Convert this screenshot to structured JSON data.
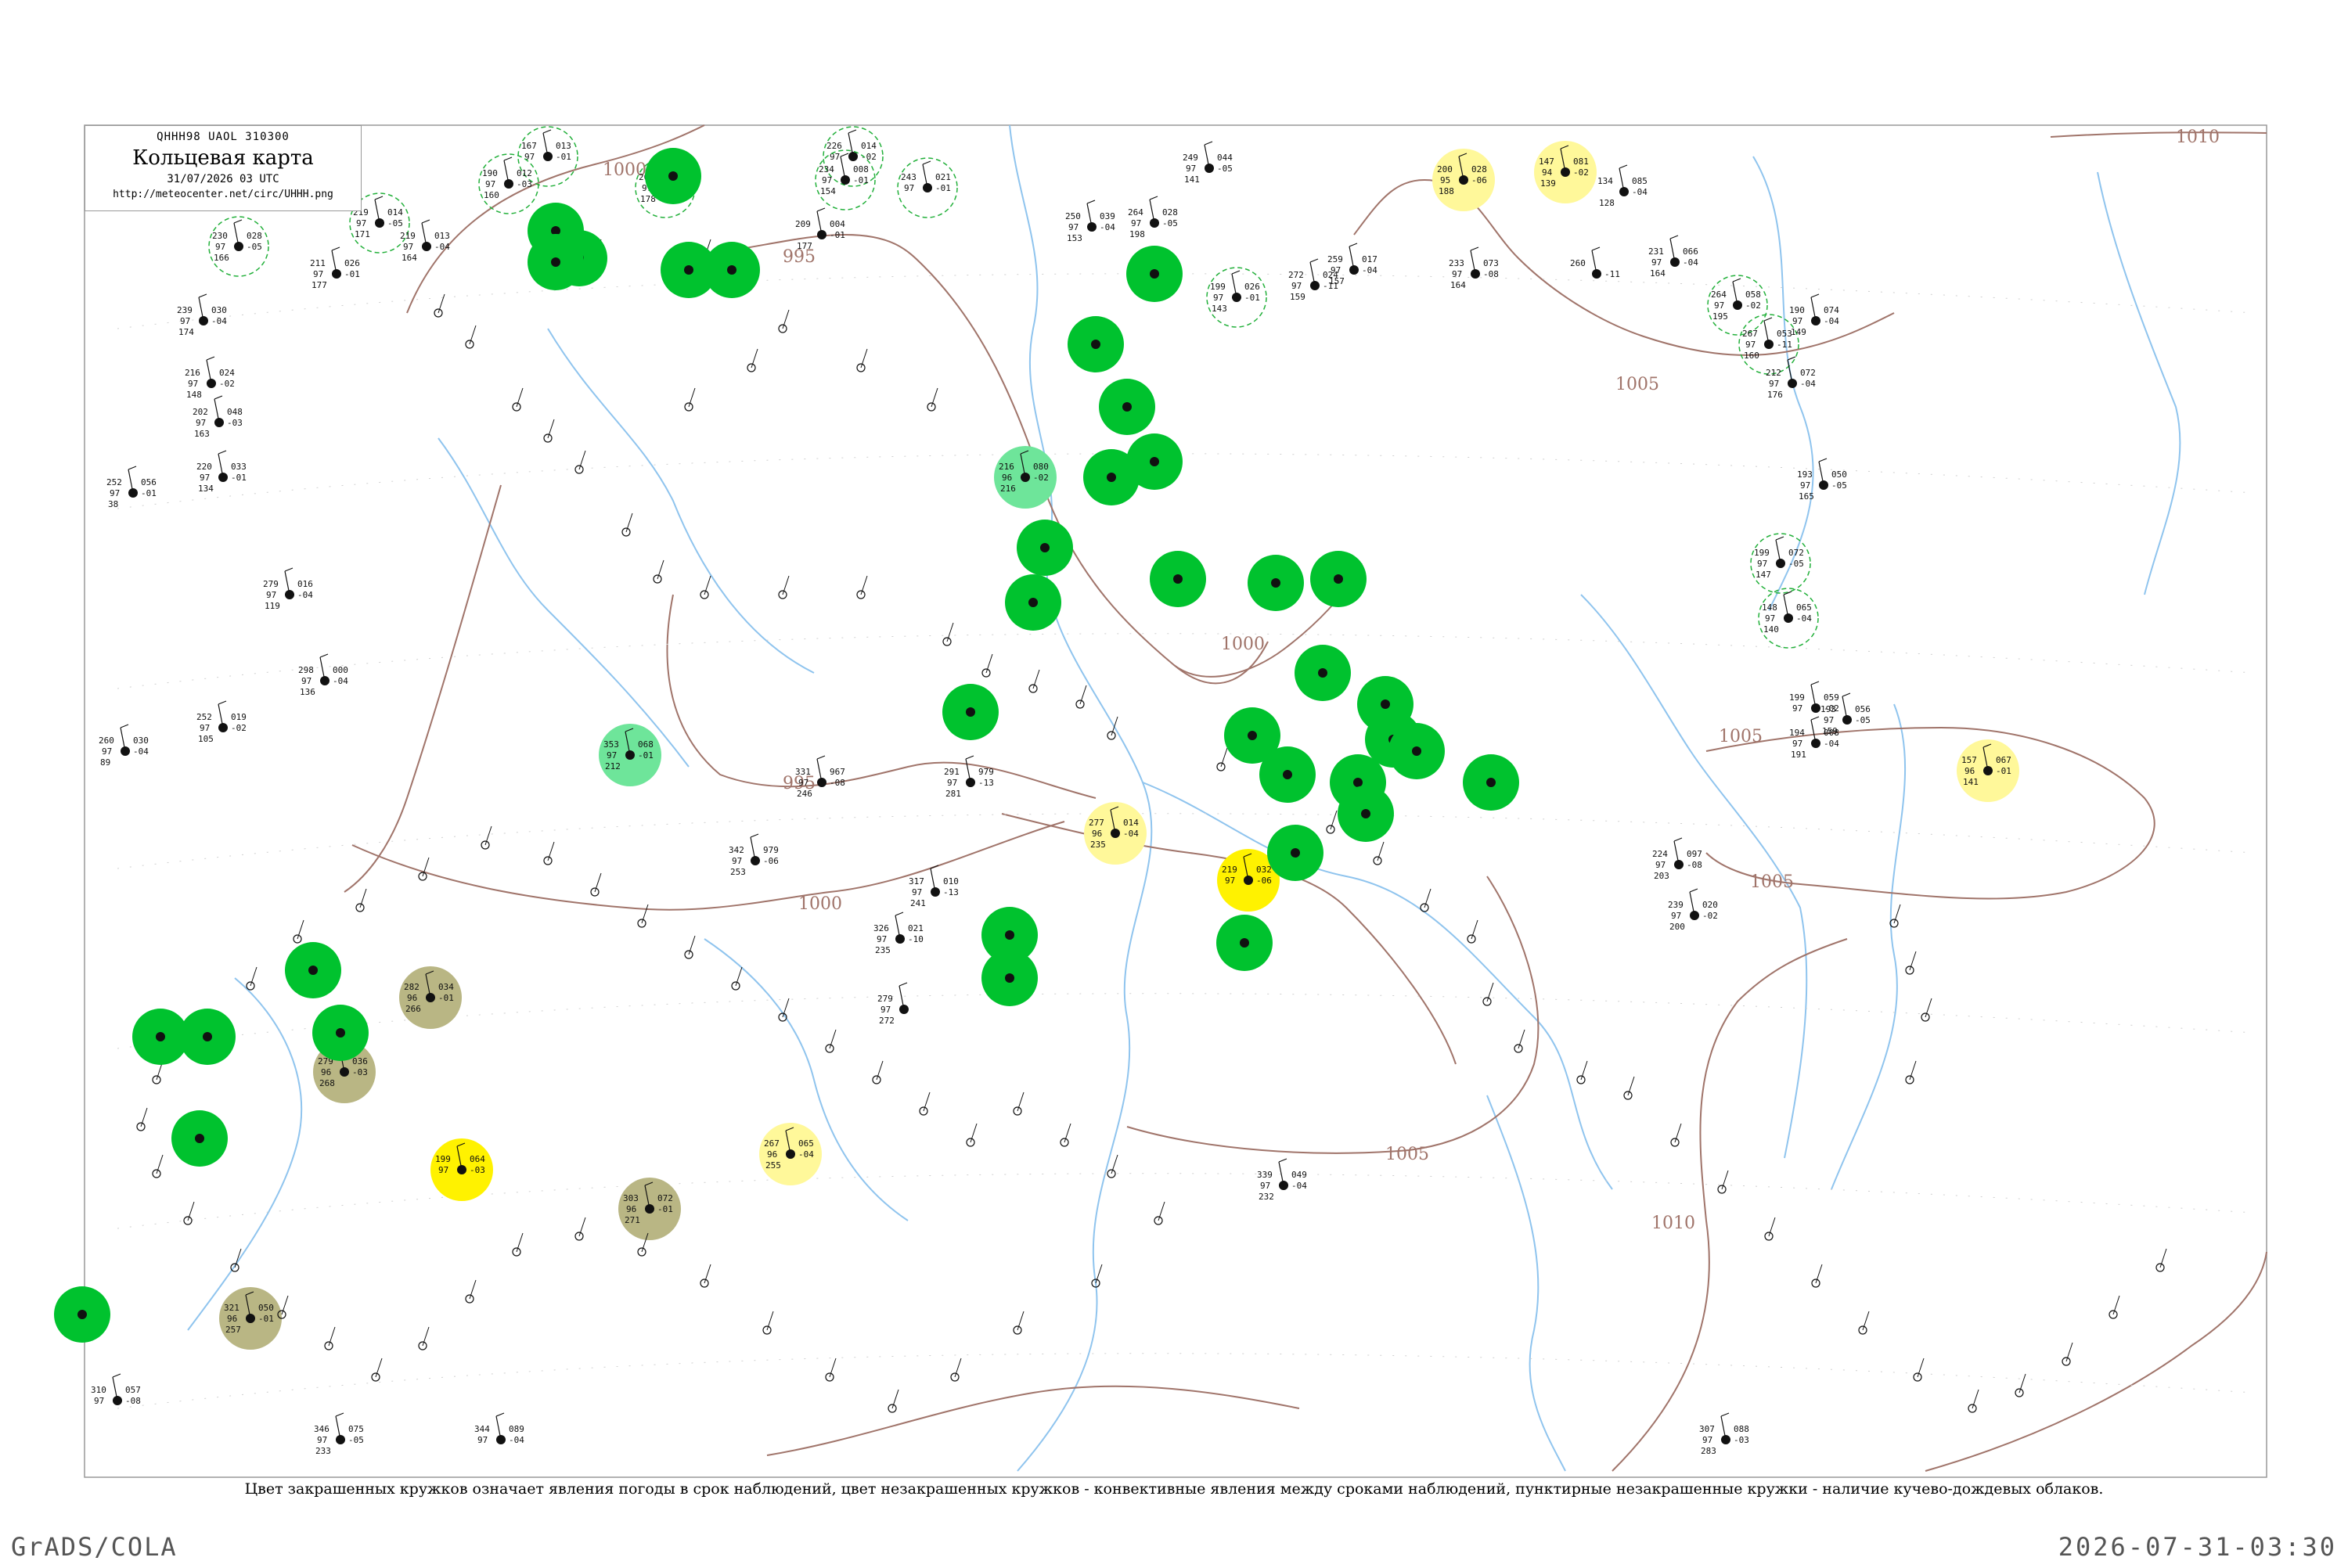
{
  "header": {
    "code": "QHHH98  UAOL  310300",
    "title": "Кольцевая карта",
    "date": "31/07/2026 03 UTC",
    "url": "http://meteocenter.net/circ/UHHH.png"
  },
  "caption": "Цвет закрашенных кружков означает явления погоды в срок наблюдений, цвет незакрашенных кружков - конвективные явления между сроками наблюдений, пунктирные незакрашенные кружки - наличие кучево-дождевых облаков.",
  "footer": {
    "left": "GrADS/COLA",
    "right": "2026-07-31-03:30"
  },
  "colors": {
    "green": "#00c22e",
    "light_green": "#6ee59a",
    "yellow": "#fff200",
    "pale_yellow": "#fff89a",
    "olive": "#b9b684",
    "isobar": "#a0746a",
    "river": "#8fc4ee",
    "dashed_ring": "#22b03a"
  },
  "isobars": [
    {
      "label": "1000",
      "label_pos": "upper-left"
    },
    {
      "label": "995",
      "label_pos": "upper-center"
    },
    {
      "label": "1000",
      "label_pos": "center"
    },
    {
      "label": "995",
      "label_pos": "lower-center"
    },
    {
      "label": "1000",
      "label_pos": "lower-left-center"
    },
    {
      "label": "1005",
      "label_pos": "upper-right"
    },
    {
      "label": "1005",
      "label_pos": "right"
    },
    {
      "label": "1005",
      "label_pos": "lower-center"
    },
    {
      "label": "1005",
      "label_pos": "lower-right"
    },
    {
      "label": "1010",
      "label_pos": "top-right"
    }
  ],
  "stations": [
    {
      "t": "167",
      "p": "013",
      "q": "97",
      "d": "-01",
      "l": "",
      "fill": "none",
      "ring": "dashed"
    },
    {
      "t": "190",
      "p": "012",
      "q": "97",
      "d": "-03",
      "l": "160",
      "fill": "none",
      "ring": "dashed"
    },
    {
      "t": "204",
      "p": "006",
      "q": "97",
      "d": "-04",
      "l": "178",
      "fill": "none",
      "ring": "dashed"
    },
    {
      "t": "226",
      "p": "014",
      "q": "97",
      "d": "-02",
      "l": "",
      "fill": "none",
      "ring": "dashed"
    },
    {
      "t": "234",
      "p": "008",
      "q": "97",
      "d": "-01",
      "l": "154",
      "fill": "none",
      "ring": "dashed"
    },
    {
      "t": "243",
      "p": "021",
      "q": "97",
      "d": "-01",
      "l": "",
      "fill": "none",
      "ring": "dashed"
    },
    {
      "t": "249",
      "p": "044",
      "q": "97",
      "d": "-05",
      "l": "141",
      "fill": "none",
      "ring": "none"
    },
    {
      "t": "200",
      "p": "028",
      "q": "95",
      "d": "-06",
      "l": "188",
      "fill": "pale_yellow",
      "ring": "none"
    },
    {
      "t": "147",
      "p": "081",
      "q": "94",
      "d": "-02",
      "l": "139",
      "fill": "pale_yellow",
      "ring": "none"
    },
    {
      "t": "134",
      "p": "085",
      "q": "",
      "d": "-04",
      "l": "128",
      "fill": "none",
      "ring": "none"
    },
    {
      "t": "230",
      "p": "028",
      "q": "97",
      "d": "-05",
      "l": "166",
      "fill": "none",
      "ring": "dashed"
    },
    {
      "t": "219",
      "p": "014",
      "q": "97",
      "d": "-05",
      "l": "171",
      "fill": "none",
      "ring": "dashed"
    },
    {
      "t": "219",
      "p": "013",
      "q": "97",
      "d": "-04",
      "l": "164",
      "fill": "none",
      "ring": "none"
    },
    {
      "t": "211",
      "p": "026",
      "q": "97",
      "d": "-01",
      "l": "177",
      "fill": "none",
      "ring": "none"
    },
    {
      "t": "239",
      "p": "030",
      "q": "97",
      "d": "-04",
      "l": "174",
      "fill": "none",
      "ring": "none"
    },
    {
      "t": "216",
      "p": "024",
      "q": "97",
      "d": "-02",
      "l": "148",
      "fill": "none",
      "ring": "none"
    },
    {
      "t": "202",
      "p": "048",
      "q": "97",
      "d": "-03",
      "l": "163",
      "fill": "none",
      "ring": "none"
    },
    {
      "t": "220",
      "p": "033",
      "q": "97",
      "d": "-01",
      "l": "134",
      "fill": "none",
      "ring": "none"
    },
    {
      "t": "252",
      "p": "056",
      "q": "97",
      "d": "-01",
      "l": "38",
      "fill": "none",
      "ring": "none"
    },
    {
      "t": "279",
      "p": "016",
      "q": "97",
      "d": "-04",
      "l": "119",
      "fill": "none",
      "ring": "none"
    },
    {
      "t": "298",
      "p": "000",
      "q": "97",
      "d": "-04",
      "l": "136",
      "fill": "none",
      "ring": "none"
    },
    {
      "t": "260",
      "p": "030",
      "q": "97",
      "d": "-04",
      "l": "89",
      "fill": "none",
      "ring": "none"
    },
    {
      "t": "252",
      "p": "019",
      "q": "97",
      "d": "-02",
      "l": "105",
      "fill": "none",
      "ring": "none"
    },
    {
      "t": "209",
      "p": "004",
      "q": "",
      "d": "-01",
      "l": "177",
      "fill": "none",
      "ring": "none"
    },
    {
      "t": "250",
      "p": "039",
      "q": "97",
      "d": "-04",
      "l": "153",
      "fill": "none",
      "ring": "none"
    },
    {
      "t": "264",
      "p": "028",
      "q": "97",
      "d": "-05",
      "l": "198",
      "fill": "none",
      "ring": "none"
    },
    {
      "t": "199",
      "p": "026",
      "q": "97",
      "d": "-01",
      "l": "143",
      "fill": "none",
      "ring": "dashed"
    },
    {
      "t": "272",
      "p": "024",
      "q": "97",
      "d": "-11",
      "l": "159",
      "fill": "none",
      "ring": "none"
    },
    {
      "t": "259",
      "p": "017",
      "q": "97",
      "d": "-04",
      "l": "157",
      "fill": "none",
      "ring": "none"
    },
    {
      "t": "233",
      "p": "073",
      "q": "97",
      "d": "-08",
      "l": "164",
      "fill": "none",
      "ring": "none"
    },
    {
      "t": "260",
      "p": "",
      "q": "",
      "d": "-11",
      "l": "",
      "fill": "none",
      "ring": "none"
    },
    {
      "t": "231",
      "p": "066",
      "q": "97",
      "d": "-04",
      "l": "164",
      "fill": "none",
      "ring": "none"
    },
    {
      "t": "264",
      "p": "058",
      "q": "97",
      "d": "-02",
      "l": "195",
      "fill": "none",
      "ring": "dashed"
    },
    {
      "t": "267",
      "p": "053",
      "q": "97",
      "d": "-11",
      "l": "160",
      "fill": "none",
      "ring": "dashed"
    },
    {
      "t": "190",
      "p": "074",
      "q": "97",
      "d": "-04",
      "l": "149",
      "fill": "none",
      "ring": "none"
    },
    {
      "t": "212",
      "p": "072",
      "q": "97",
      "d": "-04",
      "l": "176",
      "fill": "none",
      "ring": "none"
    },
    {
      "t": "193",
      "p": "050",
      "q": "97",
      "d": "-05",
      "l": "165",
      "fill": "none",
      "ring": "none"
    },
    {
      "t": "199",
      "p": "072",
      "q": "97",
      "d": "-05",
      "l": "147",
      "fill": "none",
      "ring": "dashed"
    },
    {
      "t": "148",
      "p": "065",
      "q": "97",
      "d": "-04",
      "l": "140",
      "fill": "none",
      "ring": "dashed"
    },
    {
      "t": "157",
      "p": "067",
      "q": "96",
      "d": "-01",
      "l": "141",
      "fill": "pale_yellow",
      "ring": "none"
    },
    {
      "t": "219",
      "p": "032",
      "q": "97",
      "d": "-06",
      "l": "",
      "fill": "yellow",
      "ring": "none"
    },
    {
      "t": "277",
      "p": "014",
      "q": "96",
      "d": "-04",
      "l": "235",
      "fill": "pale_yellow",
      "ring": "none"
    },
    {
      "t": "199",
      "p": "064",
      "q": "97",
      "d": "-03",
      "l": "",
      "fill": "yellow",
      "ring": "none"
    },
    {
      "t": "267",
      "p": "065",
      "q": "96",
      "d": "-04",
      "l": "255",
      "fill": "pale_yellow",
      "ring": "none"
    },
    {
      "t": "282",
      "p": "034",
      "q": "96",
      "d": "-01",
      "l": "266",
      "fill": "olive",
      "ring": "none"
    },
    {
      "t": "279",
      "p": "036",
      "q": "96",
      "d": "-03",
      "l": "268",
      "fill": "olive",
      "ring": "none"
    },
    {
      "t": "303",
      "p": "072",
      "q": "96",
      "d": "-01",
      "l": "271",
      "fill": "olive",
      "ring": "none"
    },
    {
      "t": "321",
      "p": "050",
      "q": "96",
      "d": "-01",
      "l": "257",
      "fill": "olive",
      "ring": "none"
    },
    {
      "t": "353",
      "p": "068",
      "q": "97",
      "d": "-01",
      "l": "212",
      "fill": "light_green",
      "ring": "none"
    },
    {
      "t": "216",
      "p": "080",
      "q": "96",
      "d": "-02",
      "l": "216",
      "fill": "light_green",
      "ring": "none"
    },
    {
      "t": "331",
      "p": "967",
      "q": "97",
      "d": "-08",
      "l": "246",
      "fill": "none",
      "ring": "none"
    },
    {
      "t": "291",
      "p": "979",
      "q": "97",
      "d": "-13",
      "l": "281",
      "fill": "none",
      "ring": "none"
    },
    {
      "t": "342",
      "p": "979",
      "q": "97",
      "d": "-06",
      "l": "253",
      "fill": "none",
      "ring": "none"
    },
    {
      "t": "317",
      "p": "010",
      "q": "97",
      "d": "-13",
      "l": "241",
      "fill": "none",
      "ring": "none"
    },
    {
      "t": "326",
      "p": "021",
      "q": "97",
      "d": "-10",
      "l": "235",
      "fill": "none",
      "ring": "none"
    },
    {
      "t": "279",
      "p": "",
      "q": "97",
      "d": "",
      "l": "272",
      "fill": "none",
      "ring": "none"
    },
    {
      "t": "194",
      "p": "008",
      "q": "97",
      "d": "-04",
      "l": "191",
      "fill": "none",
      "ring": "none"
    },
    {
      "t": "199",
      "p": "059",
      "q": "97",
      "d": "-02",
      "l": "",
      "fill": "none",
      "ring": "none"
    },
    {
      "t": "193",
      "p": "056",
      "q": "97",
      "d": "-05",
      "l": "159",
      "fill": "none",
      "ring": "none"
    },
    {
      "t": "224",
      "p": "097",
      "q": "97",
      "d": "-08",
      "l": "203",
      "fill": "none",
      "ring": "none"
    },
    {
      "t": "239",
      "p": "020",
      "q": "97",
      "d": "-02",
      "l": "200",
      "fill": "none",
      "ring": "none"
    },
    {
      "t": "339",
      "p": "049",
      "q": "97",
      "d": "-04",
      "l": "232",
      "fill": "none",
      "ring": "none"
    },
    {
      "t": "307",
      "p": "088",
      "q": "97",
      "d": "-03",
      "l": "283",
      "fill": "none",
      "ring": "none"
    },
    {
      "t": "310",
      "p": "057",
      "q": "97",
      "d": "-08",
      "l": "",
      "fill": "none",
      "ring": "none"
    },
    {
      "t": "346",
      "p": "075",
      "q": "97",
      "d": "-05",
      "l": "233",
      "fill": "none",
      "ring": "none"
    },
    {
      "t": "344",
      "p": "089",
      "q": "97",
      "d": "-04",
      "l": "",
      "fill": "none",
      "ring": "none"
    }
  ],
  "green_stations": [
    {
      "t": "",
      "p": "",
      "fill": "green"
    }
  ]
}
